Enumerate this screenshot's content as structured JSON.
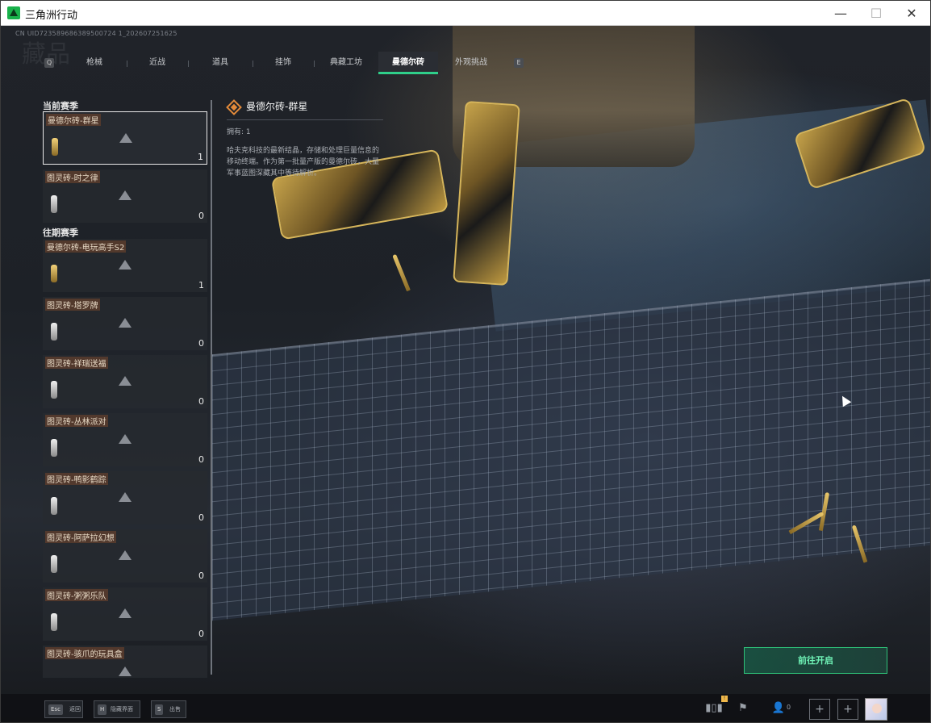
{
  "window": {
    "title": "三角洲行动",
    "min_icon": "—",
    "max_icon": "☐",
    "close_icon": "✕"
  },
  "uid_text": "CN UID723589686389500724 1_202607251625",
  "page_watermark": "藏品",
  "tabs": {
    "left_key": "Q",
    "right_key": "E",
    "items": [
      {
        "label": "枪械"
      },
      {
        "label": "近战"
      },
      {
        "label": "道具"
      },
      {
        "label": "挂饰"
      },
      {
        "label": "典藏工坊"
      },
      {
        "label": "曼德尔砖",
        "active": true
      },
      {
        "label": "外观挑战"
      }
    ]
  },
  "sidebar": {
    "current_season_label": "当前赛季",
    "past_season_label": "往期赛季",
    "current_items": [
      {
        "name": "曼德尔砖-群星",
        "count": "1",
        "icon": "gold",
        "selected": true
      },
      {
        "name": "图灵砖-时之律",
        "count": "0",
        "icon": "silver"
      }
    ],
    "past_items": [
      {
        "name": "曼德尔砖-电玩高手S2",
        "count": "1",
        "icon": "gold"
      },
      {
        "name": "图灵砖-塔罗牌",
        "count": "0",
        "icon": "silver"
      },
      {
        "name": "图灵砖-祥瑞送福",
        "count": "0",
        "icon": "silver"
      },
      {
        "name": "图灵砖-丛林派对",
        "count": "0",
        "icon": "silver"
      },
      {
        "name": "图灵砖-鸭影鹤踪",
        "count": "0",
        "icon": "silver"
      },
      {
        "name": "图灵砖-阿萨拉幻想",
        "count": "0",
        "icon": "silver"
      },
      {
        "name": "图灵砖-粥粥乐队",
        "count": "0",
        "icon": "silver"
      },
      {
        "name": "图灵砖-骇爪的玩具盒",
        "count": "",
        "icon": "silver"
      }
    ]
  },
  "detail": {
    "title": "曼德尔砖-群星",
    "owned": "拥有: 1",
    "description": "哈夫克科技的最新结晶，存储和处理巨量信息的移动终端。作为第一批量产版的曼德尔砖，大量军事蓝图深藏其中等待解析。"
  },
  "open_button_label": "前往开启",
  "bottom": {
    "esc_key": "Esc",
    "esc_label": "返回",
    "h_key": "H",
    "h_label": "隐藏界面",
    "s_key": "S",
    "s_label": "出售",
    "badge": "!",
    "friend_count": "0",
    "plus_icon": "+"
  },
  "colors": {
    "accent_green": "#2fcf8a",
    "button_text": "#6ff2b6",
    "detail_icon": "#e38a3a"
  }
}
